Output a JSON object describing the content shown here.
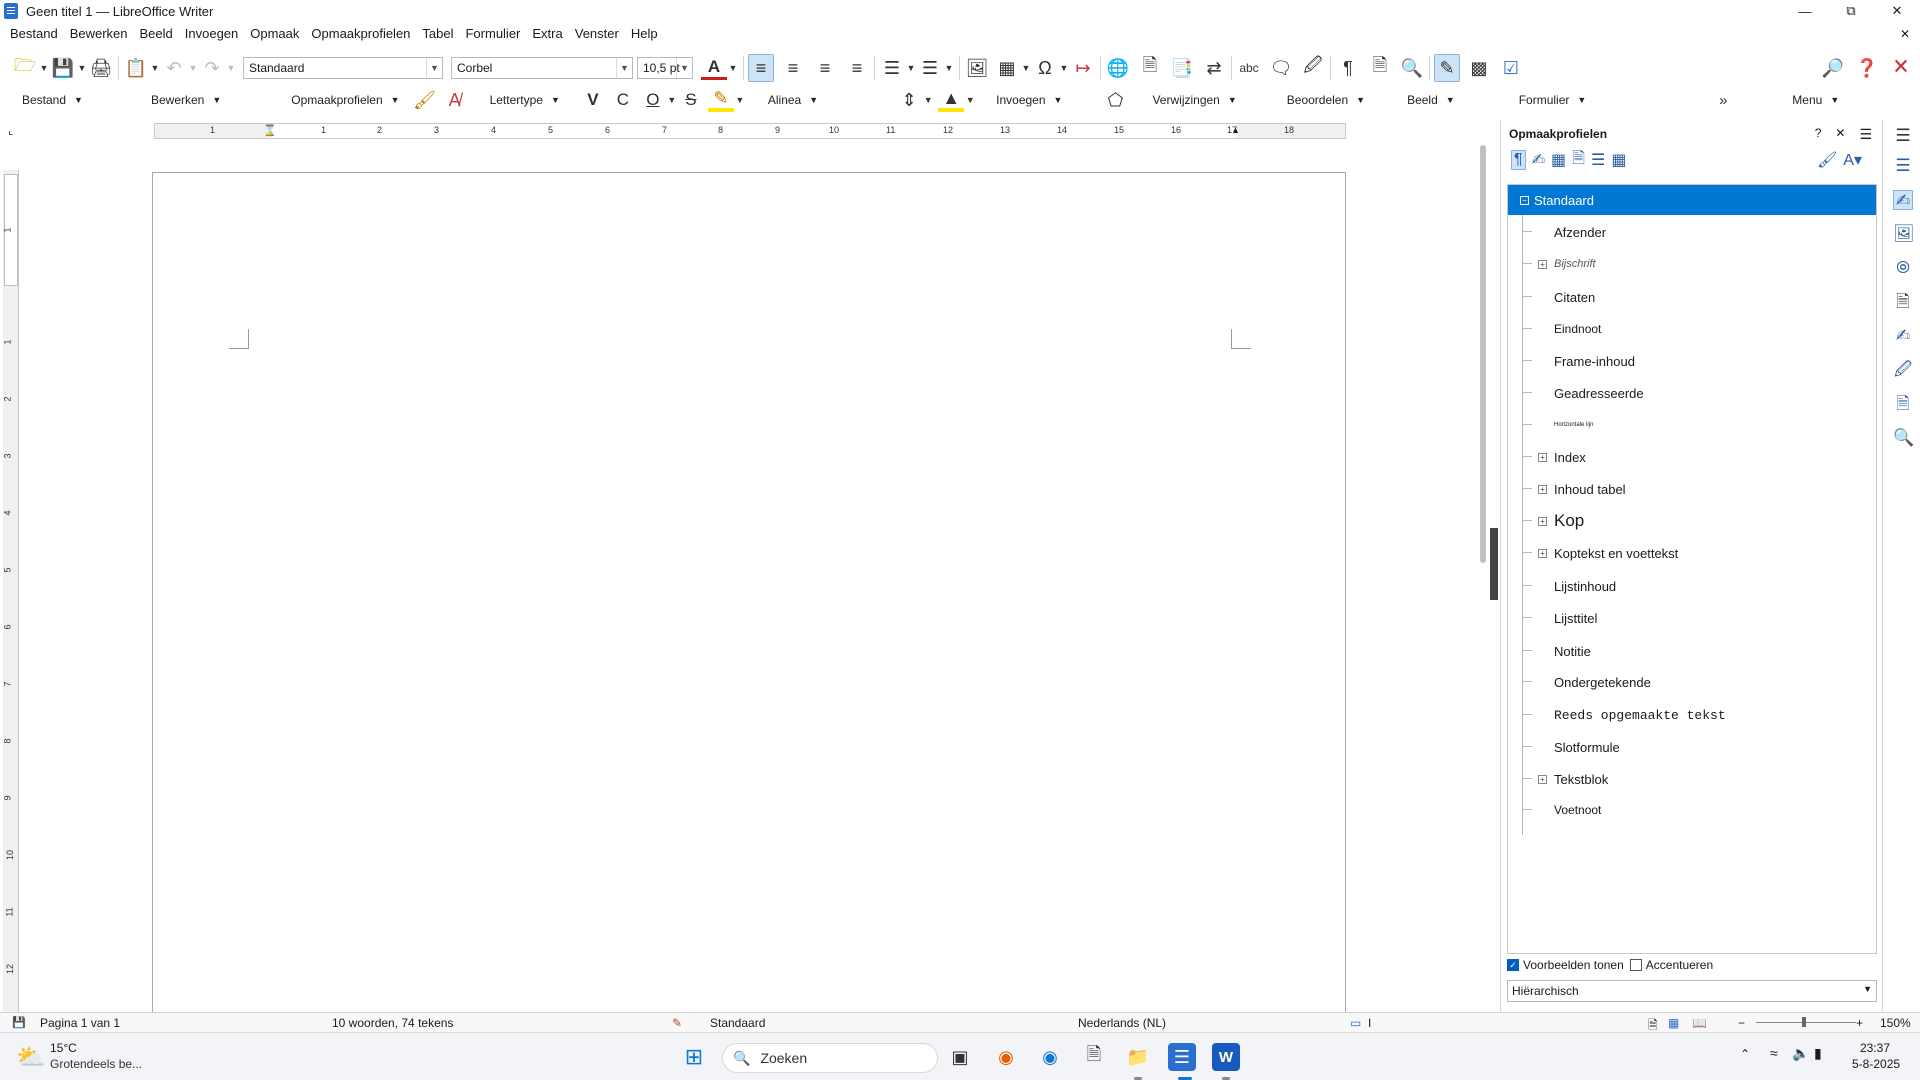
{
  "window": {
    "title": "Geen titel 1 — LibreOffice Writer"
  },
  "menu": [
    "Bestand",
    "Bewerken",
    "Beeld",
    "Invoegen",
    "Opmaak",
    "Opmaakprofielen",
    "Tabel",
    "Formulier",
    "Extra",
    "Venster",
    "Help"
  ],
  "toolbar": {
    "para_style": "Standaard",
    "font_name": "Corbel",
    "font_size": "10,5 pt",
    "groups": [
      "Bestand",
      "Bewerken",
      "Opmaakprofielen",
      "Lettertype",
      "Alinea",
      "Invoegen",
      "Verwijzingen",
      "Beoordelen",
      "Beeld",
      "Formulier",
      "Menu"
    ],
    "bold": "V",
    "italic": "C",
    "underline": "O",
    "strike": "S"
  },
  "ruler": {
    "h_labels": [
      "1",
      "1",
      "2",
      "3",
      "4",
      "5",
      "6",
      "7",
      "8",
      "9",
      "10",
      "11",
      "12",
      "13",
      "14",
      "15",
      "16",
      "17",
      "18"
    ],
    "v_labels": [
      "1",
      "1",
      "2",
      "3",
      "4",
      "5",
      "6",
      "7",
      "8",
      "9",
      "10",
      "11",
      "12"
    ]
  },
  "sidebar": {
    "title": "Opmaakprofielen",
    "help": "?",
    "close": "✕",
    "styles": [
      {
        "label": "Standaard",
        "expand": "minus",
        "selected": true
      },
      {
        "label": "Afzender",
        "expand": "none"
      },
      {
        "label": "Bijschrift",
        "expand": "plus"
      },
      {
        "label": "Citaten",
        "expand": "none"
      },
      {
        "label": "Eindnoot",
        "expand": "none"
      },
      {
        "label": "Frame-inhoud",
        "expand": "none"
      },
      {
        "label": "Geadresseerde",
        "expand": "none"
      },
      {
        "label": "Horizontale lijn",
        "expand": "none"
      },
      {
        "label": "Index",
        "expand": "plus"
      },
      {
        "label": "Inhoud tabel",
        "expand": "plus"
      },
      {
        "label": "Kop",
        "expand": "plus"
      },
      {
        "label": "Koptekst en voettekst",
        "expand": "plus"
      },
      {
        "label": "Lijstinhoud",
        "expand": "none"
      },
      {
        "label": "Lijsttitel",
        "expand": "none"
      },
      {
        "label": "Notitie",
        "expand": "none"
      },
      {
        "label": "Ondergetekende",
        "expand": "none"
      },
      {
        "label": "Reeds opgemaakte tekst",
        "expand": "none"
      },
      {
        "label": "Slotformule",
        "expand": "none"
      },
      {
        "label": "Tekstblok",
        "expand": "plus"
      },
      {
        "label": "Voetnoot",
        "expand": "none"
      }
    ],
    "show_previews": "Voorbeelden tonen",
    "highlight": "Accentueren",
    "filter": "Hiërarchisch"
  },
  "status": {
    "page": "Pagina 1 van 1",
    "words": "10 woorden, 74 tekens",
    "style": "Standaard",
    "language": "Nederlands (NL)",
    "zoom": "150%"
  },
  "taskbar": {
    "weather_temp": "15°C",
    "weather_desc": "Grotendeels be...",
    "search_placeholder": "Zoeken",
    "time": "23:37",
    "date": "5-8-2025"
  },
  "colors": {
    "accent": "#0078d4",
    "font_color": "#c81e1e",
    "highlight": "#ffe600"
  }
}
